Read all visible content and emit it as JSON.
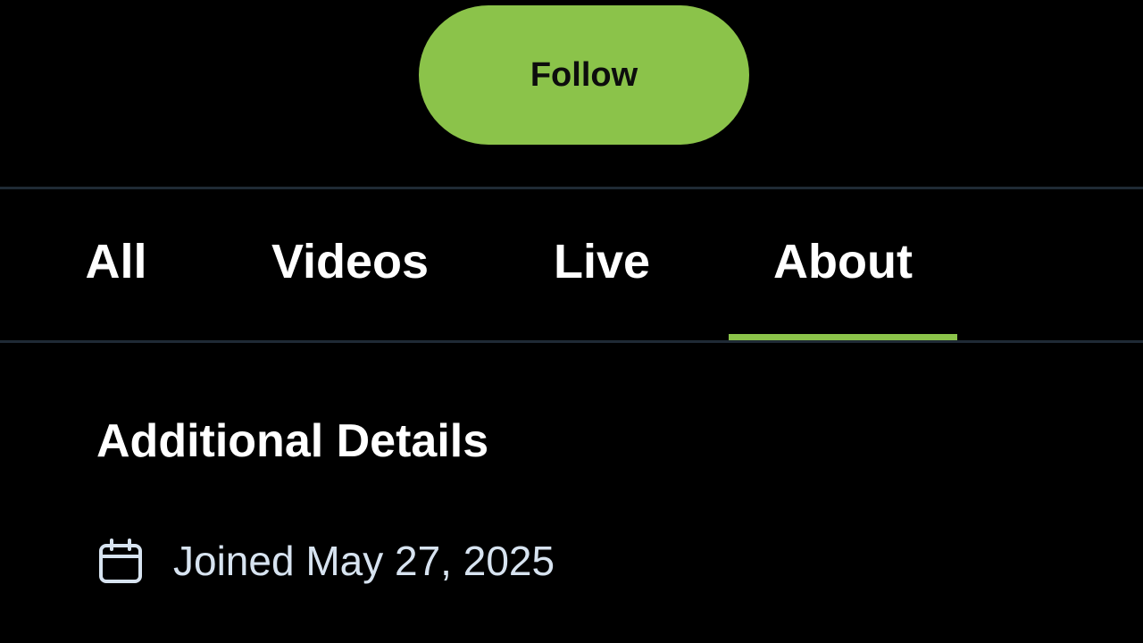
{
  "header": {
    "follow_label": "Follow"
  },
  "tabs": [
    {
      "label": "All",
      "active": false
    },
    {
      "label": "Videos",
      "active": false
    },
    {
      "label": "Live",
      "active": false
    },
    {
      "label": "About",
      "active": true
    }
  ],
  "about": {
    "section_title": "Additional Details",
    "joined_icon": "calendar-icon",
    "joined_text": "Joined May 27, 2025"
  },
  "colors": {
    "accent": "#8bc34a",
    "background": "#000000",
    "divider": "#1f2a35",
    "muted_text": "#d7e3f0"
  }
}
